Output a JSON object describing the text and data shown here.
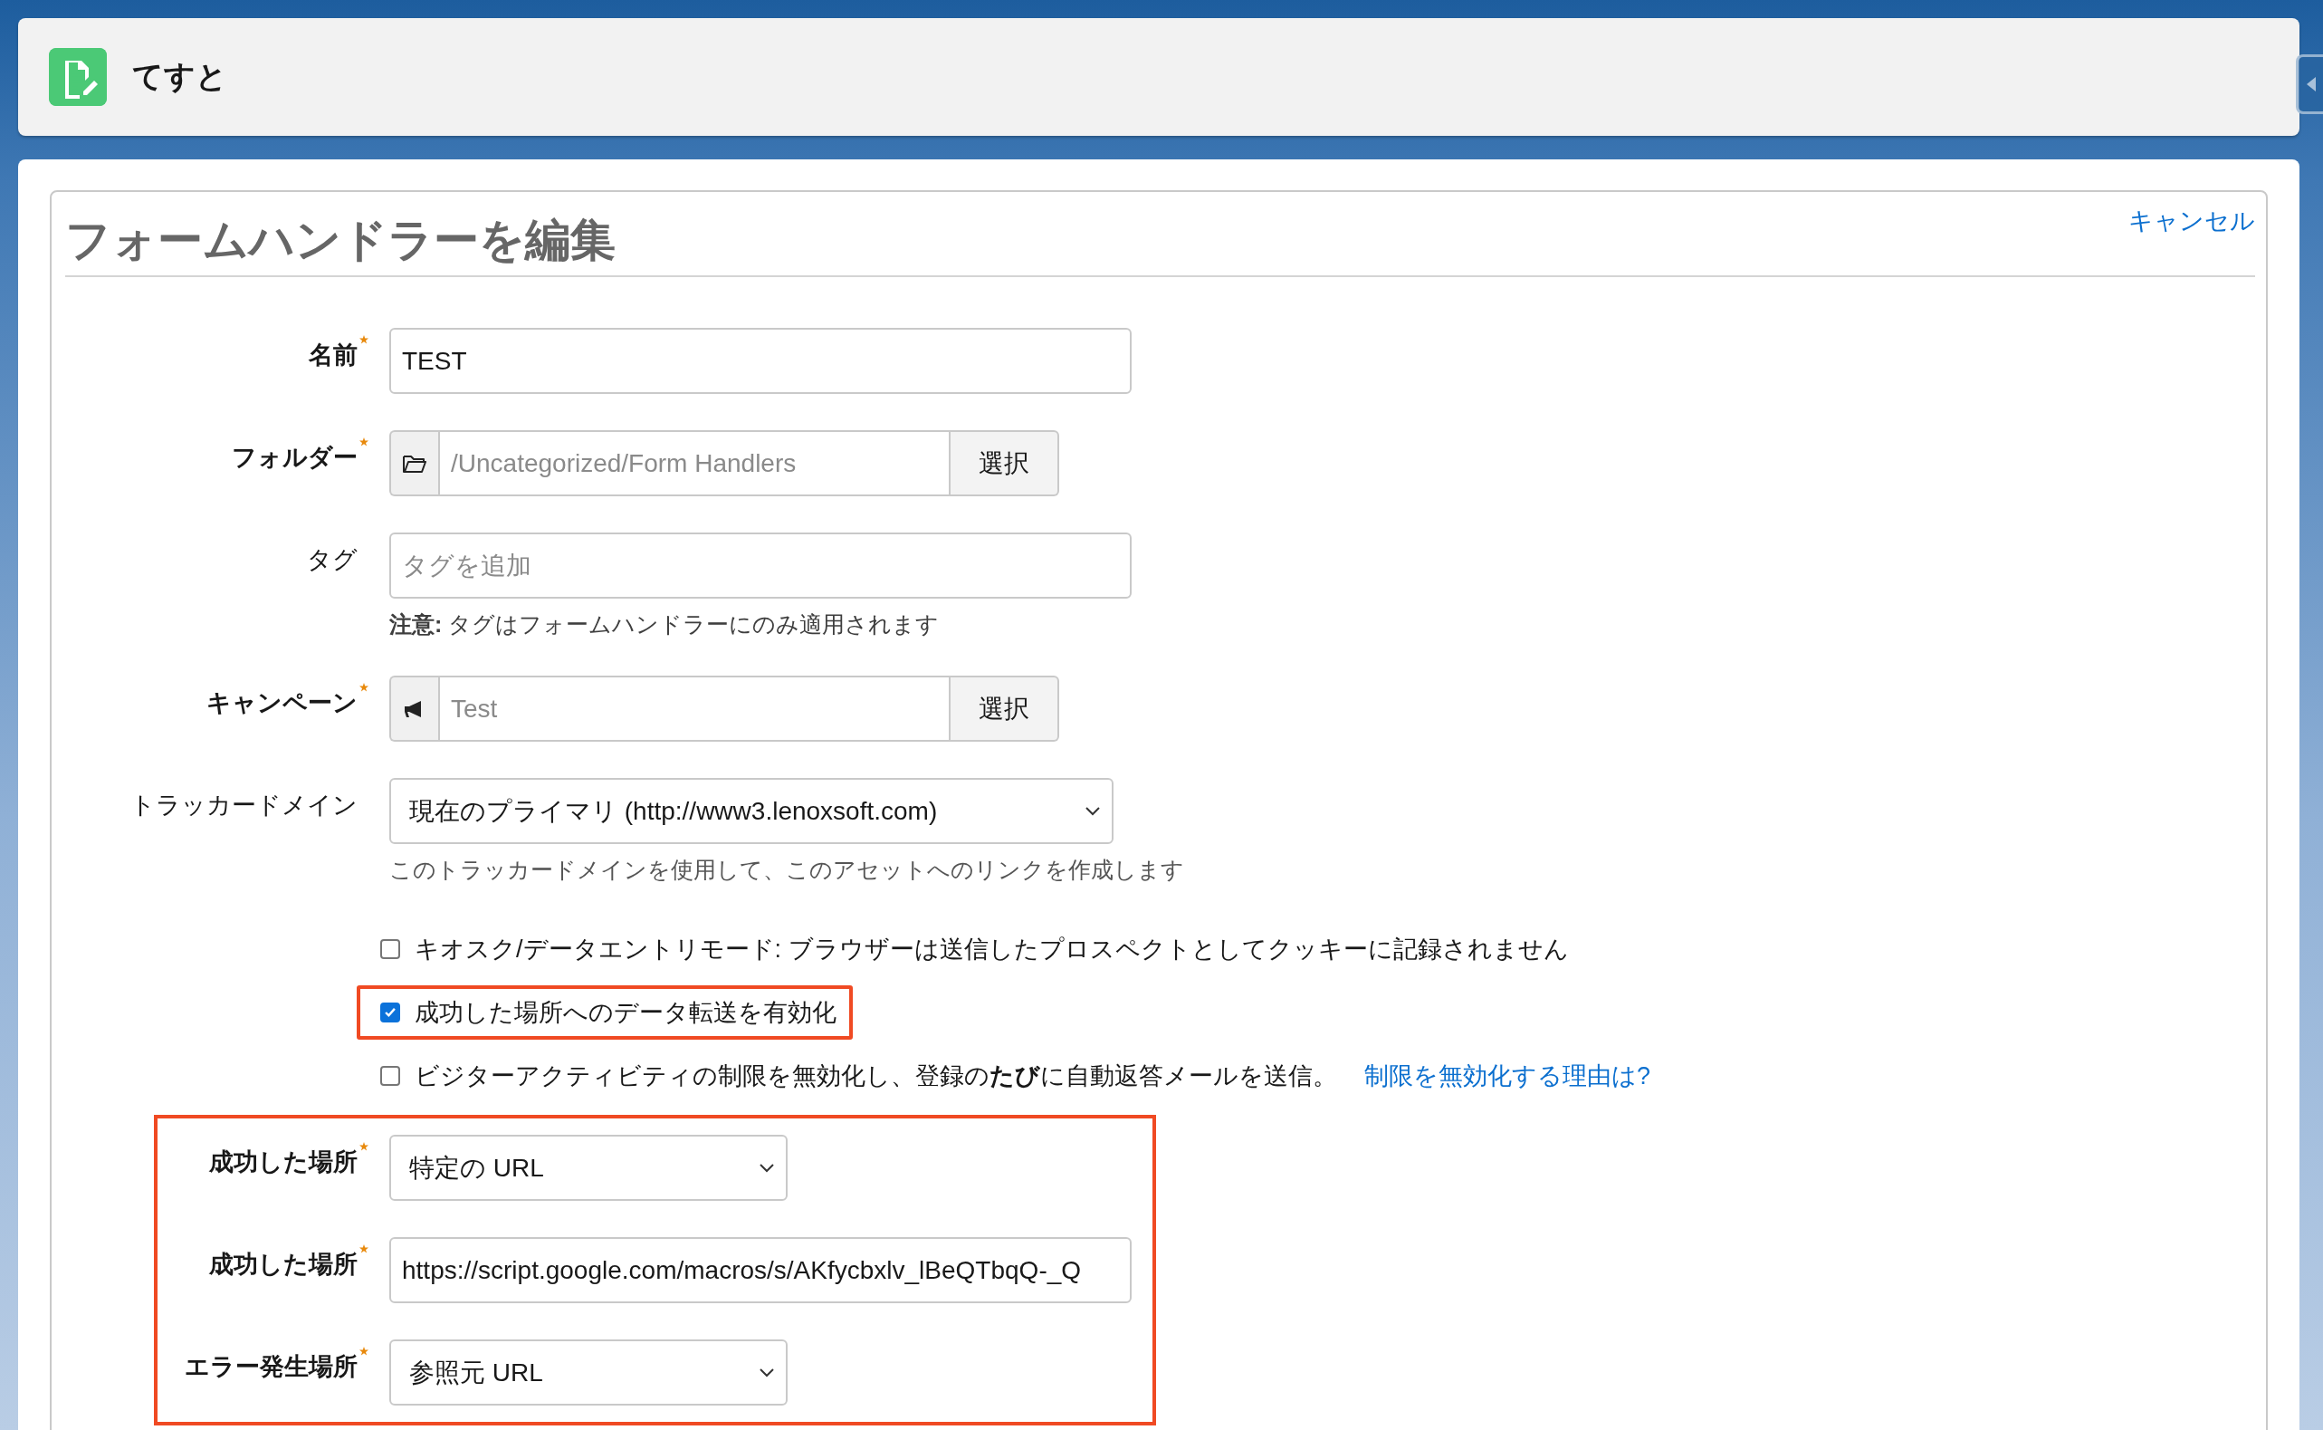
{
  "header": {
    "title": "てすと"
  },
  "form": {
    "title": "フォームハンドラーを編集",
    "cancel": "キャンセル",
    "rows": [
      {
        "kind": "text",
        "label": "名前",
        "required": true,
        "value": "TEST"
      },
      {
        "kind": "folder",
        "label": "フォルダー",
        "required": true,
        "placeholder": "/Uncategorized/Form Handlers",
        "button": "選択"
      },
      {
        "kind": "text",
        "label": "タグ",
        "required": false,
        "placeholder": "タグを追加",
        "note": "**注意:** タグはフォームハンドラーにのみ適用されます"
      },
      {
        "kind": "campaign",
        "label": "キャンペーン",
        "required": true,
        "placeholder": "Test",
        "button": "選択"
      },
      {
        "kind": "select",
        "label": "トラッカードメイン",
        "required": false,
        "value": "現在のプライマリ (http://www3.lenoxsoft.com)",
        "note": "このトラッカードメインを使用して、このアセットへのリンクを作成します"
      }
    ],
    "checkboxes": [
      {
        "label": "キオスク/データエントリモード: ブラウザーは送信したプロスペクトとしてクッキーに記録されません",
        "checked": false,
        "outlined": false
      },
      {
        "label": "成功した場所へのデータ転送を有効化",
        "checked": true,
        "outlined": true
      },
      {
        "label": "ビジターアクティビティの制限を無効化し、登録の**たび**に自動返答メールを送信。",
        "checked": false,
        "outlined": false,
        "link": "制限を無効化する理由は?"
      }
    ],
    "group": {
      "outlined": true,
      "rows": [
        {
          "kind": "select",
          "label": "成功した場所",
          "required": true,
          "value": "特定の URL",
          "short": true
        },
        {
          "kind": "text",
          "label": "成功した場所",
          "required": true,
          "value": "https://script.google.com/macros/s/AKfycbxlv_lBeQTbqQ-_Q"
        },
        {
          "kind": "select",
          "label": "エラー発生場所",
          "required": true,
          "value": "参照元 URL",
          "short": true
        }
      ]
    }
  }
}
